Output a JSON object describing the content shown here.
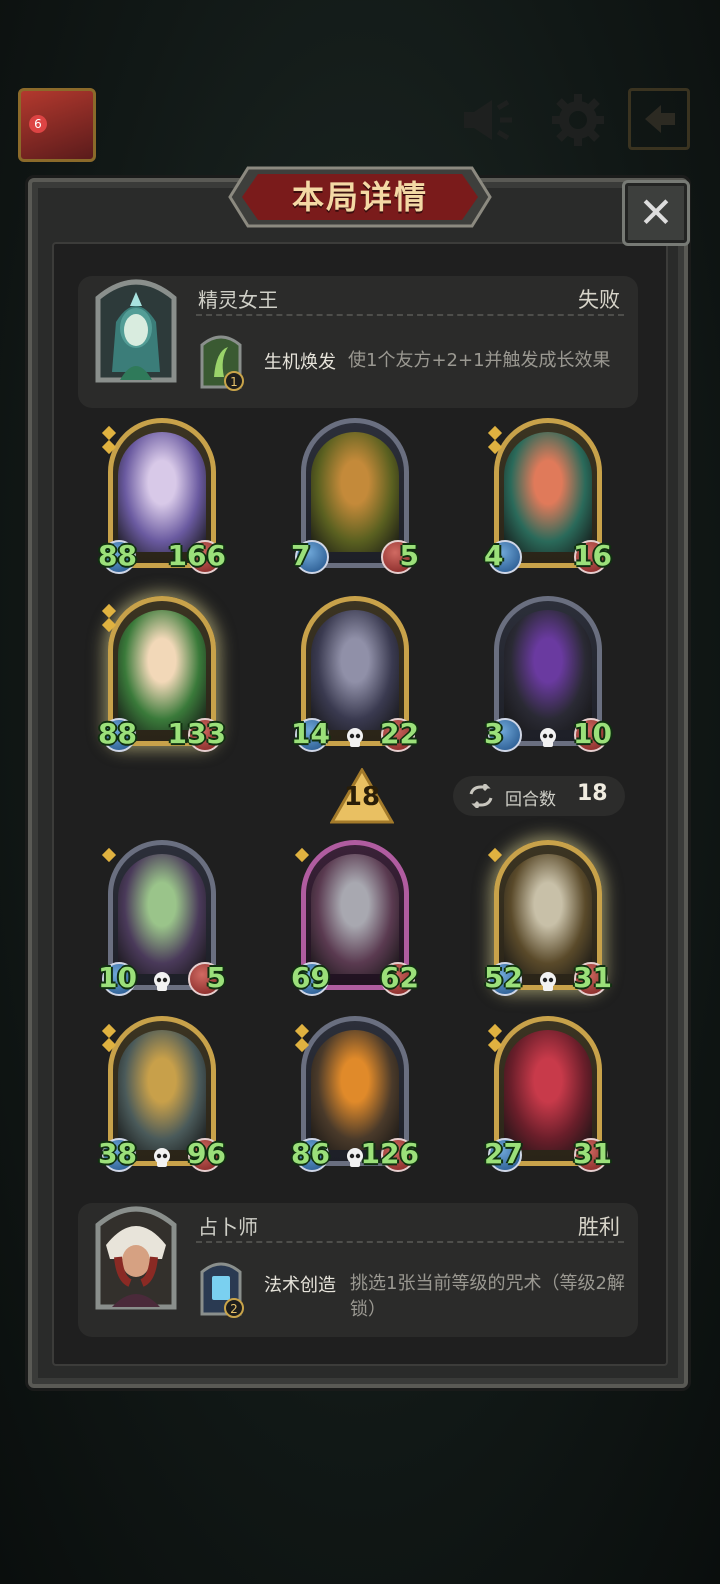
{
  "topbar": {
    "player_level": "6",
    "icons": [
      "megaphone-icon",
      "gear-icon",
      "exit-icon"
    ]
  },
  "panel": {
    "title": "本局详情",
    "close_icon": "close-icon"
  },
  "opponent": {
    "name": "精灵女王",
    "result": "失败",
    "skill_level": "1",
    "skill_name": "生机焕发",
    "skill_desc": "使1个友方+2+1并触发成长效果"
  },
  "opponent_board": [
    {
      "atk": "88",
      "hp": "166",
      "frame": "gold",
      "tier": 2,
      "skull": false,
      "glow": false
    },
    {
      "atk": "7",
      "hp": "5",
      "frame": "silver",
      "tier": 0,
      "skull": false,
      "glow": false
    },
    {
      "atk": "4",
      "hp": "16",
      "frame": "gold",
      "tier": 2,
      "skull": false,
      "glow": false
    },
    {
      "atk": "88",
      "hp": "133",
      "frame": "gold",
      "tier": 2,
      "skull": false,
      "glow": true
    },
    {
      "atk": "14",
      "hp": "22",
      "frame": "gold",
      "tier": 0,
      "skull": true,
      "glow": false
    },
    {
      "atk": "3",
      "hp": "10",
      "frame": "silver",
      "tier": 0,
      "skull": true,
      "glow": false
    }
  ],
  "round": {
    "current": "18",
    "label": "回合数",
    "value": "18"
  },
  "player_board": [
    {
      "atk": "10",
      "hp": "5",
      "frame": "silver",
      "tier": 1,
      "skull": true,
      "glow": false
    },
    {
      "atk": "69",
      "hp": "62",
      "frame": "pink",
      "tier": 1,
      "skull": false,
      "glow": false
    },
    {
      "atk": "52",
      "hp": "31",
      "frame": "gold",
      "tier": 1,
      "skull": true,
      "glow": true
    },
    {
      "atk": "38",
      "hp": "96",
      "frame": "gold",
      "tier": 2,
      "skull": true,
      "glow": false
    },
    {
      "atk": "86",
      "hp": "126",
      "frame": "silver",
      "tier": 2,
      "skull": true,
      "glow": false
    },
    {
      "atk": "27",
      "hp": "31",
      "frame": "gold",
      "tier": 2,
      "skull": false,
      "glow": false
    }
  ],
  "player": {
    "name": "占卜师",
    "result": "胜利",
    "skill_level": "2",
    "skill_name": "法术创造",
    "skill_desc": "挑选1张当前等级的咒术（等级2解锁）"
  }
}
